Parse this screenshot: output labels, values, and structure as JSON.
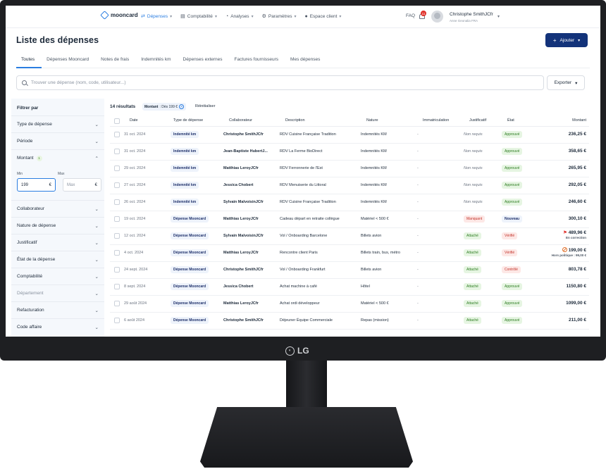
{
  "nav": {
    "brand": "mooncard",
    "items": [
      {
        "label": "Dépenses",
        "icon": "⇄",
        "active": true
      },
      {
        "label": "Comptabilité",
        "icon": "▤",
        "active": false
      },
      {
        "label": "Analyses",
        "icon": "◔",
        "active": false
      },
      {
        "label": "Paramètres",
        "icon": "⚙",
        "active": false
      },
      {
        "label": "Espace client",
        "icon": "●",
        "active": false
      }
    ],
    "faq": "FAQ",
    "notif_count": "11",
    "user_name": "Christophe SmithJCfr",
    "user_org": "Anne Geonalia FRA"
  },
  "page": {
    "title": "Liste des dépenses",
    "add_label": "Ajouter",
    "tabs": [
      "Toutes",
      "Dépenses Mooncard",
      "Notes de frais",
      "Indemnités km",
      "Dépenses externes",
      "Factures fournisseurs",
      "Mes dépenses"
    ],
    "search_placeholder": "Trouver une dépense (nom, code, utilisateur...)",
    "export_label": "Exporter"
  },
  "filters": {
    "heading": "Filtrer par",
    "type": "Type de dépense",
    "period": "Période",
    "amount": "Montant",
    "amount_count": "1",
    "min_label": "Min",
    "max_label": "Max",
    "min_value": "199",
    "max_placeholder": "Max",
    "currency": "€",
    "collab": "Collaborateur",
    "nature": "Nature de dépense",
    "just": "Justificatif",
    "state": "État de la dépense",
    "compta": "Comptabilité",
    "dept": "Département",
    "refact": "Refacturation",
    "code": "Code affaire"
  },
  "results": {
    "count": "14 résultats",
    "chip_label": "Montant",
    "chip_value": ": Dès 199 €",
    "reset": "Réinitialiser"
  },
  "table": {
    "headers": {
      "date": "Date",
      "type": "Type de dépense",
      "collab": "Collaborateur",
      "desc": "Description",
      "nature": "Nature",
      "immat": "Immatriculation",
      "just": "Justificatif",
      "state": "État",
      "amount": "Montant"
    },
    "rows": [
      {
        "date": "31 oct. 2024",
        "type": "Indemnité km",
        "collab": "Christophe SmithJCfr",
        "desc": "RDV Cuisine Française Tradition",
        "nature": "Indemnités KM",
        "immat": "-",
        "just": "Non requis",
        "state": "Approuvé",
        "amount": "236,25 €"
      },
      {
        "date": "31 oct. 2024",
        "type": "Indemnité km",
        "collab": "Jean-Baptiste HubertJ...",
        "desc": "RDV La Ferme BioDirect",
        "nature": "Indemnités KM",
        "immat": "-",
        "just": "Non requis",
        "state": "Approuvé",
        "amount": "358,65 €"
      },
      {
        "date": "29 oct. 2024",
        "type": "Indemnité km",
        "collab": "Matthias LeroyJCfr",
        "desc": "RDV Ferronnerie de l'Est",
        "nature": "Indemnités KM",
        "immat": "-",
        "just": "Non requis",
        "state": "Approuvé",
        "amount": "265,95 €"
      },
      {
        "date": "27 oct. 2024",
        "type": "Indemnité km",
        "collab": "Jessica Chobert",
        "desc": "RDV Menuiserie du Littoral",
        "nature": "Indemnités KM",
        "immat": "-",
        "just": "Non requis",
        "state": "Approuvé",
        "amount": "292,05 €"
      },
      {
        "date": "26 oct. 2024",
        "type": "Indemnité km",
        "collab": "Sylvain MalvoisinJCfr",
        "desc": "RDV Cuisine Française Tradition",
        "nature": "Indemnités KM",
        "immat": "-",
        "just": "Non requis",
        "state": "Approuvé",
        "amount": "246,60 €"
      },
      {
        "date": "19 oct. 2024",
        "type": "Dépense Mooncard",
        "collab": "Matthias LeroyJCfr",
        "desc": "Cadeau départ en retraite collègue",
        "nature": "Matériel < 500 €",
        "immat": "-",
        "just": "Manquant",
        "state": "Nouveau",
        "amount": "300,10 €"
      },
      {
        "date": "12 oct. 2024",
        "type": "Dépense Mooncard",
        "collab": "Sylvain MalvoisinJCfr",
        "desc": "Vol / Onboarding Barcelone",
        "nature": "Billets avion",
        "immat": "-",
        "just": "Attaché",
        "state": "Vérifié",
        "amount": "489,96 €",
        "sub": "En correction"
      },
      {
        "date": "4 oct. 2024",
        "type": "Dépense Mooncard",
        "collab": "Matthias LeroyJCfr",
        "desc": "Rencontre client Paris",
        "nature": "Billets train, bus, métro",
        "immat": "-",
        "just": "Attaché",
        "state": "Vérifié",
        "amount": "199,00 €",
        "sub": "Hors politique : 99,00 €"
      },
      {
        "date": "24 sept. 2024",
        "type": "Dépense Mooncard",
        "collab": "Christophe SmithJCfr",
        "desc": "Vol / Onboarding Frankfurt",
        "nature": "Billets avion",
        "immat": "-",
        "just": "Attaché",
        "state": "Contrôlé",
        "amount": "803,78 €"
      },
      {
        "date": "8 sept. 2024",
        "type": "Dépense Mooncard",
        "collab": "Jessica Chobert",
        "desc": "Achat machine à café",
        "nature": "Hôtel",
        "immat": "-",
        "just": "Attaché",
        "state": "Approuvé",
        "amount": "1150,80 €"
      },
      {
        "date": "29 août 2024",
        "type": "Dépense Mooncard",
        "collab": "Matthias LeroyJCfr",
        "desc": "Achat ordi développeur",
        "nature": "Matériel < 500 €",
        "immat": "-",
        "just": "Attaché",
        "state": "Approuvé",
        "amount": "1099,00 €"
      },
      {
        "date": "6 août 2024",
        "type": "Dépense Mooncard",
        "collab": "Christophe SmithJCfr",
        "desc": "Déjeuner Équipe Commerciale",
        "nature": "Repas (mission)",
        "immat": "-",
        "just": "Attaché",
        "state": "Approuvé",
        "amount": "211,00 €"
      }
    ]
  },
  "monitor": {
    "brand": "LG"
  },
  "colors": {
    "accent": "#2a7de1",
    "primary_button": "#13337a",
    "approved": "#2e7d22",
    "missing": "#c3342b",
    "bezel": "#1e1f22"
  }
}
